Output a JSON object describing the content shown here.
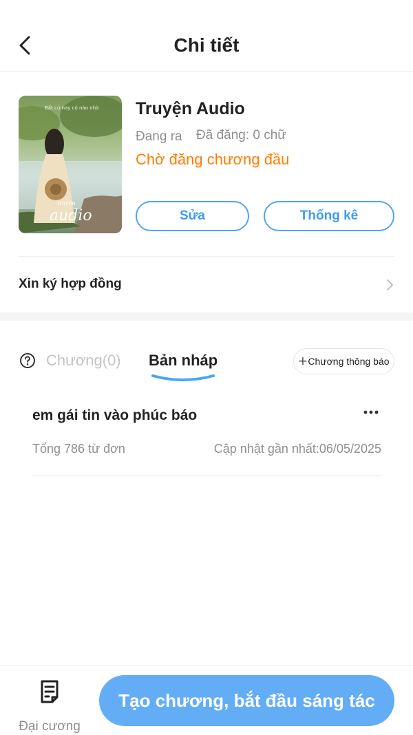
{
  "header": {
    "title": "Chi tiết"
  },
  "book": {
    "cover_caption": "Bất cứ nay có nào nhà",
    "cover_art_text": "audio",
    "cover_art_small": "truyện",
    "title": "Truyện Audio",
    "status": "Đang ra",
    "word_count": "Đã đăng: 0 chữ",
    "waiting": "Chờ đăng chương đầu",
    "edit_label": "Sửa",
    "stats_label": "Thống kê"
  },
  "contract": {
    "label": "Xin ký hợp đồng"
  },
  "tabs": {
    "chapters": "Chương(0)",
    "draft": "Bản nháp",
    "notice_label": "Chương thông báo"
  },
  "drafts": [
    {
      "title": "em gái tin vào phúc báo",
      "words": "Tổng 786 từ đơn",
      "updated": "Cập nhật gần nhất:06/05/2025"
    }
  ],
  "bottom": {
    "outline_label": "Đại cương",
    "create_label": "Tạo chương, bắt đầu sáng tác"
  },
  "colors": {
    "accent": "#4ba5f6",
    "orange": "#ff7d00",
    "create_button": "#63adf7"
  },
  "icons": {
    "back": "chevron-left-icon",
    "help": "question-circle-icon",
    "more": "more-horizontal-icon",
    "outline": "document-icon",
    "plus": "plus-icon",
    "chevron": "chevron-right-icon"
  }
}
